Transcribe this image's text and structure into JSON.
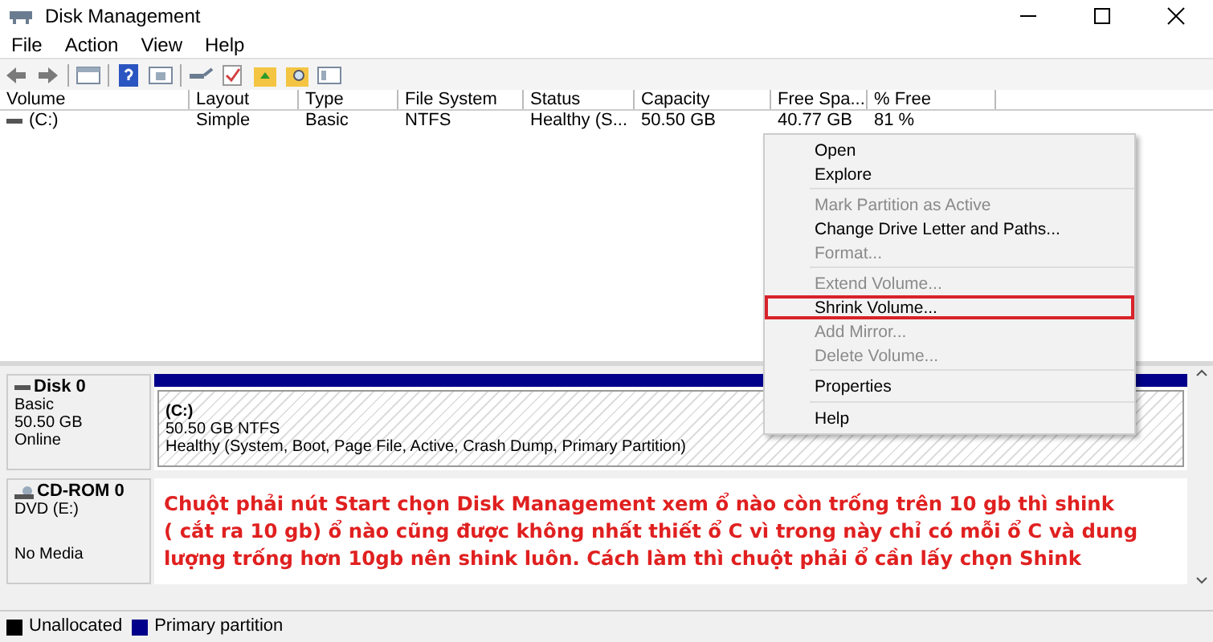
{
  "window": {
    "title": "Disk Management"
  },
  "menu_bar": [
    "File",
    "Action",
    "View",
    "Help"
  ],
  "volume_table": {
    "columns": [
      "Volume",
      "Layout",
      "Type",
      "File System",
      "Status",
      "Capacity",
      "Free Spa...",
      "% Free"
    ],
    "rows": [
      {
        "cells": [
          "(C:)",
          "Simple",
          "Basic",
          "NTFS",
          "Healthy (S...",
          "50.50 GB",
          "40.77 GB",
          "81 %"
        ]
      }
    ]
  },
  "context_menu": [
    {
      "kind": "item",
      "label": "Open",
      "disabled": false,
      "selected": false
    },
    {
      "kind": "item",
      "label": "Explore",
      "disabled": false,
      "selected": false
    },
    {
      "kind": "separator"
    },
    {
      "kind": "item",
      "label": "Mark Partition as Active",
      "disabled": true,
      "selected": false
    },
    {
      "kind": "item",
      "label": "Change Drive Letter and Paths...",
      "disabled": false,
      "selected": false
    },
    {
      "kind": "item",
      "label": "Format...",
      "disabled": true,
      "selected": false
    },
    {
      "kind": "separator"
    },
    {
      "kind": "item",
      "label": "Extend Volume...",
      "disabled": true,
      "selected": false
    },
    {
      "kind": "item",
      "label": "Shrink Volume...",
      "disabled": false,
      "selected": true
    },
    {
      "kind": "item",
      "label": "Add Mirror...",
      "disabled": true,
      "selected": false
    },
    {
      "kind": "item",
      "label": "Delete Volume...",
      "disabled": true,
      "selected": false
    },
    {
      "kind": "separator"
    },
    {
      "kind": "item",
      "label": "Properties",
      "disabled": false,
      "selected": false
    },
    {
      "kind": "separator"
    },
    {
      "kind": "item",
      "label": "Help",
      "disabled": false,
      "selected": false
    }
  ],
  "disks": [
    {
      "kind": "disk",
      "name": "Disk 0",
      "details": [
        "Basic",
        "50.50 GB",
        "Online"
      ],
      "partition": {
        "name": "(C:)",
        "size": "50.50 GB NTFS",
        "status": "Healthy (System, Boot, Page File, Active, Crash Dump, Primary Partition)"
      }
    },
    {
      "kind": "cdrom",
      "name": "CD-ROM 0",
      "details": [
        "DVD (E:)",
        "No Media"
      ]
    }
  ],
  "annotation": [
    "Chuột phải nút Start chọn Disk Management xem ổ nào còn trống trên 10 gb thì shink",
    "( cắt ra 10 gb) ổ nào cũng được không nhất thiết ổ C vì trong này chỉ có mỗi ổ C và dung",
    "lượng trống hơn 10gb nên shink luôn. Cách làm thì chuột phải ổ cần lấy chọn Shink"
  ],
  "legend": [
    {
      "label": "Unallocated",
      "color": "#000000"
    },
    {
      "label": "Primary partition",
      "color": "#00008b"
    }
  ]
}
